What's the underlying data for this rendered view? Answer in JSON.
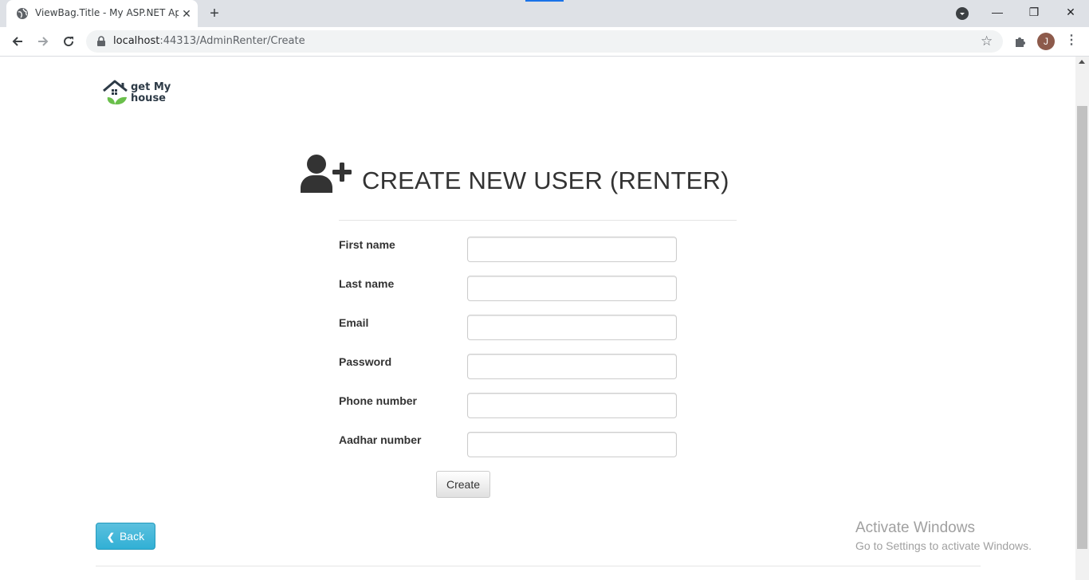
{
  "browser": {
    "tab_title": "ViewBag.Title - My ASP.NET Appl",
    "tab_close": "✕",
    "new_tab": "+",
    "url_host": "localhost",
    "url_rest": ":44313/AdminRenter/Create",
    "avatar_initial": "J",
    "window_controls": [
      "—",
      "❐",
      "✕"
    ]
  },
  "page": {
    "logo_line1": "get My",
    "logo_line2": "house",
    "heading": "CREATE NEW USER (RENTER)",
    "heading_icon": "user-plus-icon",
    "fields": [
      {
        "label": "First name",
        "value": ""
      },
      {
        "label": "Last name",
        "value": ""
      },
      {
        "label": "Email",
        "value": ""
      },
      {
        "label": "Password",
        "value": ""
      },
      {
        "label": "Phone number",
        "value": ""
      },
      {
        "label": "Aadhar number",
        "value": ""
      }
    ],
    "create_label": "Create",
    "back_label": "Back"
  },
  "watermark": {
    "title": "Activate Windows",
    "subtitle": "Go to Settings to activate Windows."
  },
  "colors": {
    "back_button": "#5bc0de",
    "logo_leaf": "#6abf4b",
    "logo_house": "#2e3b47"
  }
}
